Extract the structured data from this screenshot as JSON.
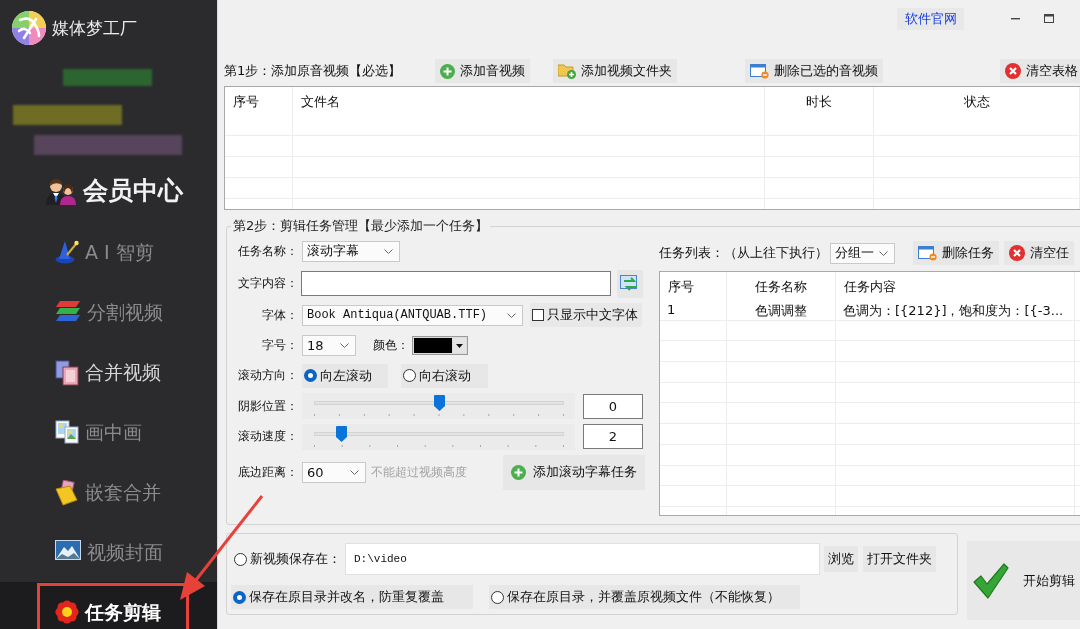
{
  "sidebar": {
    "app_name": "媒体梦工厂",
    "items": [
      {
        "label": "会员中心",
        "kind": "vip",
        "selected": false,
        "hovered": false,
        "highlighted": false
      },
      {
        "label": "A I 智剪",
        "kind": "tool",
        "selected": false,
        "hovered": false,
        "highlighted": false
      },
      {
        "label": "分割视频",
        "kind": "tool",
        "selected": false,
        "hovered": false,
        "highlighted": false
      },
      {
        "label": "合并视频",
        "kind": "tool",
        "selected": false,
        "hovered": true,
        "highlighted": false
      },
      {
        "label": "画中画",
        "kind": "tool",
        "selected": false,
        "hovered": false,
        "highlighted": false
      },
      {
        "label": "嵌套合并",
        "kind": "tool",
        "selected": false,
        "hovered": false,
        "highlighted": false
      },
      {
        "label": "视频封面",
        "kind": "tool",
        "selected": false,
        "hovered": false,
        "highlighted": false
      },
      {
        "label": "任务剪辑",
        "kind": "tool",
        "selected": true,
        "hovered": false,
        "highlighted": true
      }
    ]
  },
  "header": {
    "link": "软件官网"
  },
  "step1": {
    "title": "第1步：添加原音视频【必选】",
    "buttons": [
      "添加音视频",
      "添加视频文件夹",
      "删除已选的音视频",
      "清空表格"
    ],
    "table": {
      "columns": [
        "序号",
        "文件名",
        "时长",
        "状态"
      ]
    }
  },
  "step2": {
    "title": "第2步：剪辑任务管理【最少添加一个任务】",
    "task_name": {
      "label": "任务名称：",
      "value": "滚动字幕"
    },
    "text_content": {
      "label": "文字内容："
    },
    "font": {
      "label": "字体：",
      "value": "Book Antiqua(ANTQUAB.TTF)"
    },
    "chinese_only": {
      "label": "只显示中文字体",
      "checked": false
    },
    "font_size": {
      "label": "字号：",
      "value": "18"
    },
    "font_color": {
      "label": "颜色：",
      "color": "#000000"
    },
    "direction": {
      "label": "滚动方向：",
      "options": [
        {
          "label": "向左滚动",
          "selected": true
        },
        {
          "label": "向右滚动",
          "selected": false
        }
      ]
    },
    "sliders": [
      {
        "label": "阴影位置：",
        "level": 0.5,
        "reading": "0"
      },
      {
        "label": "滚动速度：",
        "level": 0.11,
        "reading": "2"
      }
    ],
    "bottom_margin": {
      "label": "底边距离：",
      "value": "60",
      "note": "不能超过视频高度"
    },
    "add_button": "添加滚动字幕任务"
  },
  "task_list": {
    "label": "任务列表：（从上往下执行）",
    "group": "分组一",
    "buttons": [
      "删除任务",
      "清空任"
    ],
    "columns": [
      "序号",
      "任务名称",
      "任务内容"
    ],
    "rows": [
      [
        "1",
        "色调调整",
        "色调为：[{212}]，饱和度为：[{-3..."
      ]
    ]
  },
  "output": {
    "new_path": {
      "label": "新视频保存在：",
      "selected": false,
      "value": "D:\\video"
    },
    "buttons": [
      "浏览",
      "打开文件夹"
    ],
    "options": [
      {
        "label": "保存在原目录并改名，防重复覆盖",
        "selected": true
      },
      {
        "label": "保存在原目录，并覆盖原视频文件（不能恢复）",
        "selected": false
      }
    ]
  },
  "start_button": "开始剪辑"
}
